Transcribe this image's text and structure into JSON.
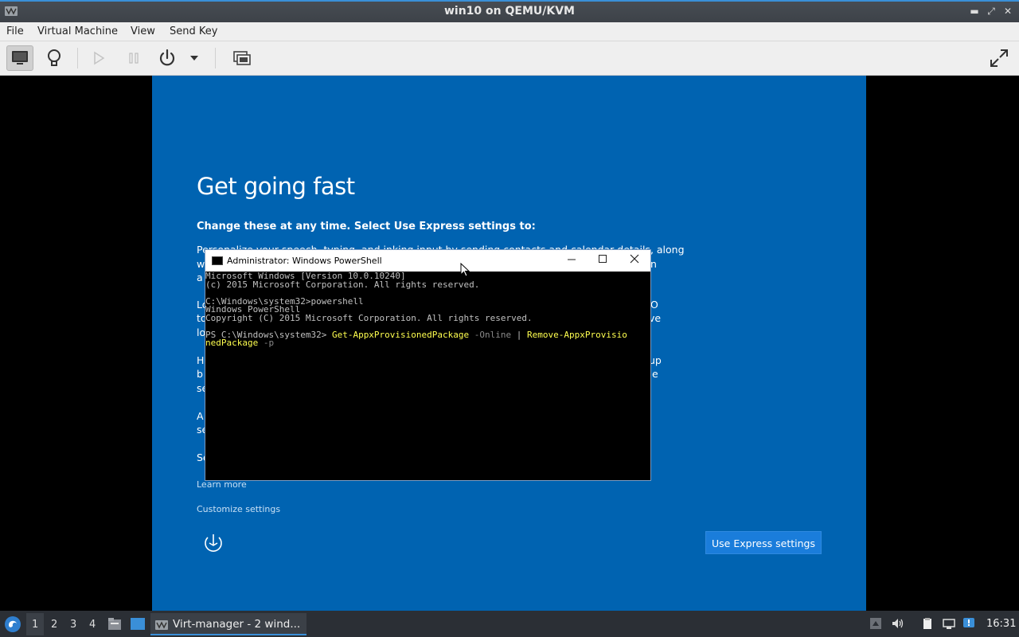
{
  "window": {
    "title": "win10 on QEMU/KVM",
    "minimize_glyph": "▬",
    "maximize_glyph": "⤢",
    "close_glyph": "✕"
  },
  "menu": {
    "file": "File",
    "virtual_machine": "Virtual Machine",
    "view": "View",
    "send_key": "Send Key"
  },
  "oobe": {
    "title": "Get going fast",
    "subtitle": "Change these at any time. Select Use Express settings to:",
    "para1_line1": "Personalize your speech, typing, and inking input by sending contacts and calendar details, along",
    "para1_w": "w",
    "para1_n": "n",
    "para1_a": "a",
    "para2_l1": "Lo",
    "para2_o": "O",
    "para2_t": "to",
    "para2_ve": "ve",
    "para2_l3": "lo",
    "para3_h": "H",
    "para3_up": "up",
    "para3_b": "b",
    "para3_e": "e",
    "para3_se": "se",
    "para4_a": "A",
    "para4_se": "se",
    "para5_se": "Se",
    "learn_more": "Learn more",
    "customize": "Customize settings",
    "express_button": "Use Express settings"
  },
  "powershell": {
    "title": "Administrator: Windows PowerShell",
    "lines": {
      "l1": "Microsoft Windows [Version 10.0.10240]",
      "l2": "(c) 2015 Microsoft Corporation. All rights reserved.",
      "l3": "C:\\Windows\\system32>powershell",
      "l4": "Windows PowerShell",
      "l5": "Copyright (C) 2015 Microsoft Corporation. All rights reserved.",
      "prompt": "PS C:\\Windows\\system32> ",
      "cmd1": "Get-AppxProvisionedPackage",
      "arg1": " -Online",
      "pipe": " | ",
      "cmd2a": "Remove-AppxProvisio",
      "cmd2b": "nedPackage",
      "arg2": " -p"
    }
  },
  "taskbar": {
    "workspaces": [
      "1",
      "2",
      "3",
      "4"
    ],
    "active_task": "Virt-manager - 2 wind...",
    "clock": "16:31"
  },
  "colors": {
    "oobe_bg": "#0063b1",
    "accent": "#3a8fd8",
    "express_button": "#1a7ddb"
  }
}
